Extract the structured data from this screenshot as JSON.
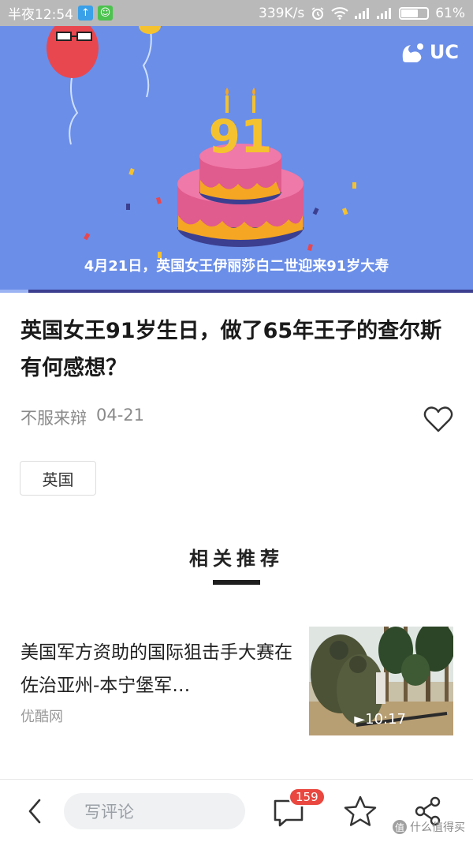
{
  "status_bar": {
    "time": "半夜12:54",
    "speed": "339K/s",
    "battery": "61%",
    "battery_level": 0.61
  },
  "hero": {
    "cake_number": "91",
    "caption": "4月21日，英国女王伊丽莎白二世迎来91岁大寿",
    "logo_text": "UC",
    "video_progress": 0.06
  },
  "article": {
    "title": "英国女王91岁生日，做了65年王子的查尔斯有何感想？",
    "author": "不服来辩",
    "date": "04-21",
    "tag": "英国"
  },
  "related": {
    "heading": "相关推荐",
    "items": [
      {
        "title": "美国军方资助的国际狙击手大赛在佐治亚州-本宁堡军…",
        "source": "优酷网",
        "duration": "►10:17"
      }
    ]
  },
  "bottom_bar": {
    "comment_placeholder": "写评论",
    "comment_count": "159",
    "watermark": "什么值得买",
    "watermark_mark": "值"
  },
  "icons": {
    "back": "chevron-left-icon",
    "comment": "speech-bubble-icon",
    "favorite": "star-icon",
    "share": "share-icon",
    "like": "heart-icon"
  }
}
